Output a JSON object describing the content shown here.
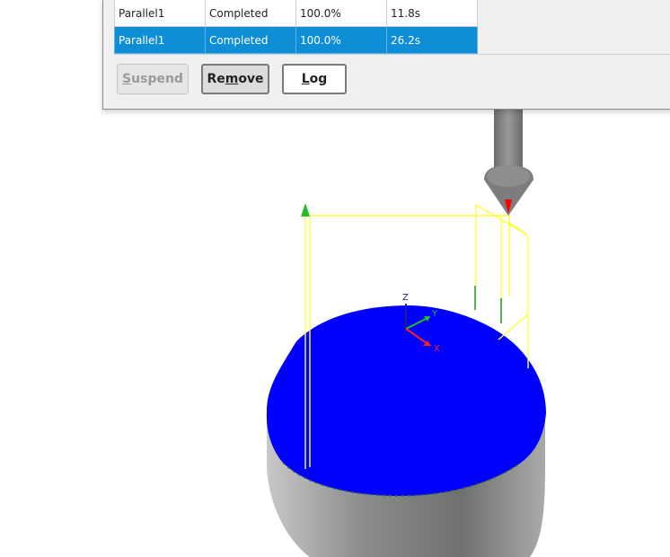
{
  "jobs_table": {
    "rows": [
      {
        "name": "Parallel1",
        "status": "Completed",
        "progress": "100.0%",
        "time": "11.8s",
        "selected": false
      },
      {
        "name": "Parallel1",
        "status": "Completed",
        "progress": "100.0%",
        "time": "26.2s",
        "selected": true
      }
    ]
  },
  "buttons": {
    "suspend": {
      "pre": "",
      "key": "S",
      "post": "uspend",
      "enabled": false
    },
    "remove": {
      "pre": "Re",
      "key": "m",
      "post": "ove",
      "enabled": true
    },
    "log": {
      "pre": "",
      "key": "L",
      "post": "og",
      "enabled": true
    }
  },
  "scene": {
    "axis_labels": {
      "z": "Z",
      "y": "Y",
      "x": "X"
    },
    "colors": {
      "stock_top": "#0000ff",
      "stock_body": "#8c8e8c",
      "boundary": "#ffff3a",
      "tool": "#7d7d7d",
      "tool_tip": "#ff0000",
      "axis_x": "#ff2020",
      "axis_y": "#20c020",
      "axis_z": "#202080",
      "selection": "#0e8ed6"
    },
    "icons": [
      "tool-holder-icon",
      "origin-triad-icon",
      "up-arrow-icon"
    ]
  }
}
